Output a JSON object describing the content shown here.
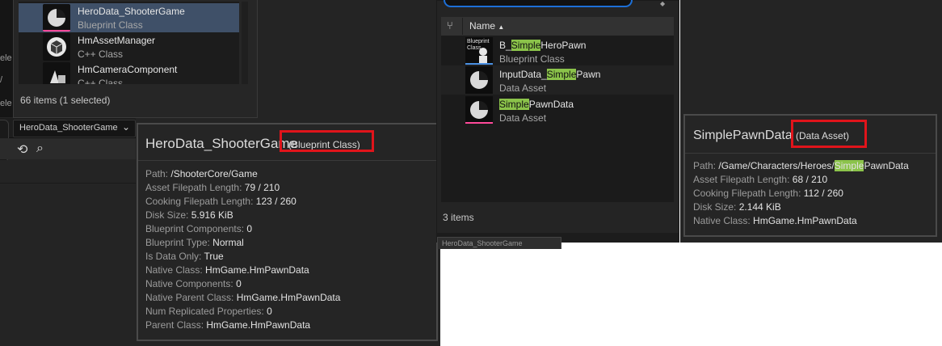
{
  "left_gutter": {
    "labels": [
      "ele",
      "/",
      "ele"
    ]
  },
  "picker": {
    "items": [
      {
        "name": "HeroData_ShooterGame",
        "type": "Blueprint Class",
        "selected": true,
        "icon": "pie-asset-icon",
        "bar_color": "#ff4a9a"
      },
      {
        "name": "HmAssetManager",
        "type": "C++ Class",
        "selected": false,
        "icon": "cube-class-icon",
        "bar_color": ""
      },
      {
        "name": "HmCameraComponent",
        "type": "C++ Class",
        "selected": false,
        "icon": "camera-class-icon",
        "bar_color": ""
      }
    ],
    "count": "66 items (1 selected)"
  },
  "toolbar": {
    "combo_value": "HeroData_ShooterGame",
    "chevron": "⌄",
    "back_icon": "⟲",
    "find_icon": "⌕"
  },
  "tooltip_left": {
    "title": "HeroData_ShooterGame",
    "type": "(Blueprint Class)",
    "props": [
      {
        "k": "Path:",
        "v": "/ShooterCore/Game"
      },
      {
        "k": "Asset Filepath Length:",
        "v": "79 / 210"
      },
      {
        "k": "Cooking Filepath Length:",
        "v": "123 / 260"
      },
      {
        "k": "Disk Size:",
        "v": "5.916 KiB"
      },
      {
        "k": "Blueprint Components:",
        "v": "0"
      },
      {
        "k": "Blueprint Type:",
        "v": "Normal"
      },
      {
        "k": "Is Data Only:",
        "v": "True"
      },
      {
        "k": "Native Class:",
        "v": "HmGame.HmPawnData"
      },
      {
        "k": "Native Components:",
        "v": "0"
      },
      {
        "k": "Native Parent Class:",
        "v": "HmGame.HmPawnData"
      },
      {
        "k": "Num Replicated Properties:",
        "v": "0"
      },
      {
        "k": "Parent Class:",
        "v": "HmGame.HmPawnData"
      }
    ]
  },
  "middle": {
    "header": {
      "column": "Name",
      "sort_icon": "▲"
    },
    "items": [
      {
        "pre": "B_",
        "hl": "Simple",
        "post": "HeroPawn",
        "type": "Blueprint Class",
        "thumb_label": "Blueprint Class",
        "bar_color": "#4a90e2"
      },
      {
        "pre": "InputData_",
        "hl": "Simple",
        "post": "Pawn",
        "type": "Data Asset",
        "thumb_label": "",
        "bar_color": ""
      },
      {
        "pre": "",
        "hl": "Simple",
        "post": "PawnData",
        "type": "Data Asset",
        "thumb_label": "",
        "bar_color": "#ff4a9a"
      }
    ],
    "count": "3 items",
    "tab": "HeroData_ShooterGame"
  },
  "tooltip_right": {
    "title": "SimplePawnData",
    "type": "(Data Asset)",
    "path_key": "Path:",
    "path_pre": "/Game/Characters/Heroes/",
    "path_hl": "Simple",
    "path_post": "PawnData",
    "props": [
      {
        "k": "Asset Filepath Length:",
        "v": "68 / 210"
      },
      {
        "k": "Cooking Filepath Length:",
        "v": "112 / 260"
      },
      {
        "k": "Disk Size:",
        "v": "2.144 KiB"
      },
      {
        "k": "Native Class:",
        "v": "HmGame.HmPawnData"
      }
    ]
  },
  "colors": {
    "highlight_box": "#e0141b",
    "search_highlight": "#8bc34a",
    "selection": "#3f5068"
  }
}
